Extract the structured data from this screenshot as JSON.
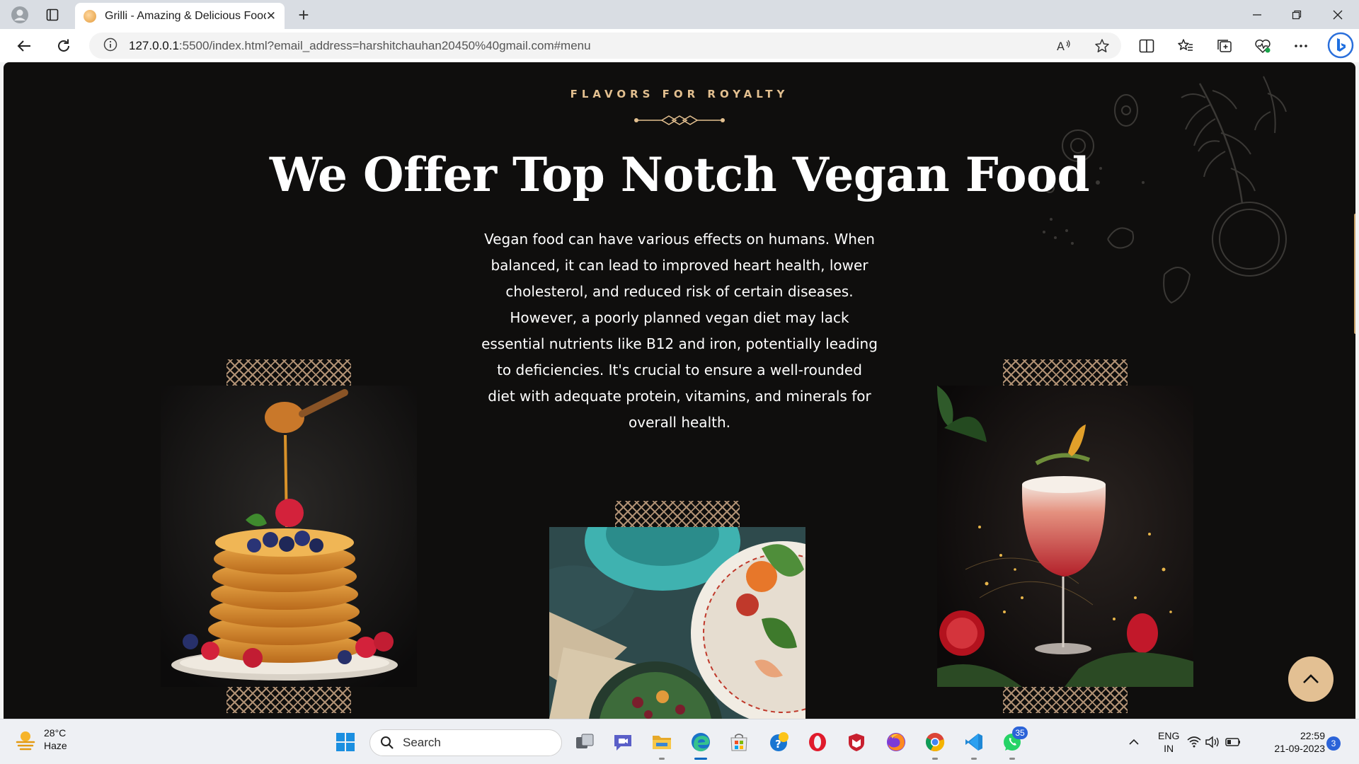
{
  "browser": {
    "tab_title": "Grilli - Amazing & Delicious Food",
    "url_host": "127.0.0.1",
    "url_rest": ":5500/index.html?email_address=harshitchauhan20450%40gmail.com#menu",
    "new_tab_label": "+",
    "tab_close_label": "✕"
  },
  "page": {
    "subtitle": "FLAVORS FOR ROYALTY",
    "heading": "We Offer Top Notch Vegan Food",
    "description": "Vegan food can have various effects on humans. When balanced, it can lead to improved heart health, lower cholesterol, and reduced risk of certain diseases. However, a poorly planned vegan diet may lack essential nutrients like B12 and iron, potentially leading to deficiencies. It's crucial to ensure a well-rounded diet with adequate protein, vitamins, and minerals for overall health.",
    "images": [
      {
        "name": "pancakes-image",
        "subject": "pancake stack with honey and berries"
      },
      {
        "name": "salad-image",
        "subject": "salad bowl with flatbread"
      },
      {
        "name": "cocktail-image",
        "subject": "red cocktail with garnish"
      }
    ],
    "accent_color": "#e2bf8f"
  },
  "taskbar": {
    "weather_temp": "28°C",
    "weather_desc": "Haze",
    "search_label": "Search",
    "whatsapp_badge": "35",
    "lang_line1": "ENG",
    "lang_line2": "IN",
    "time": "22:59",
    "date": "21-09-2023",
    "notifications": "3"
  }
}
